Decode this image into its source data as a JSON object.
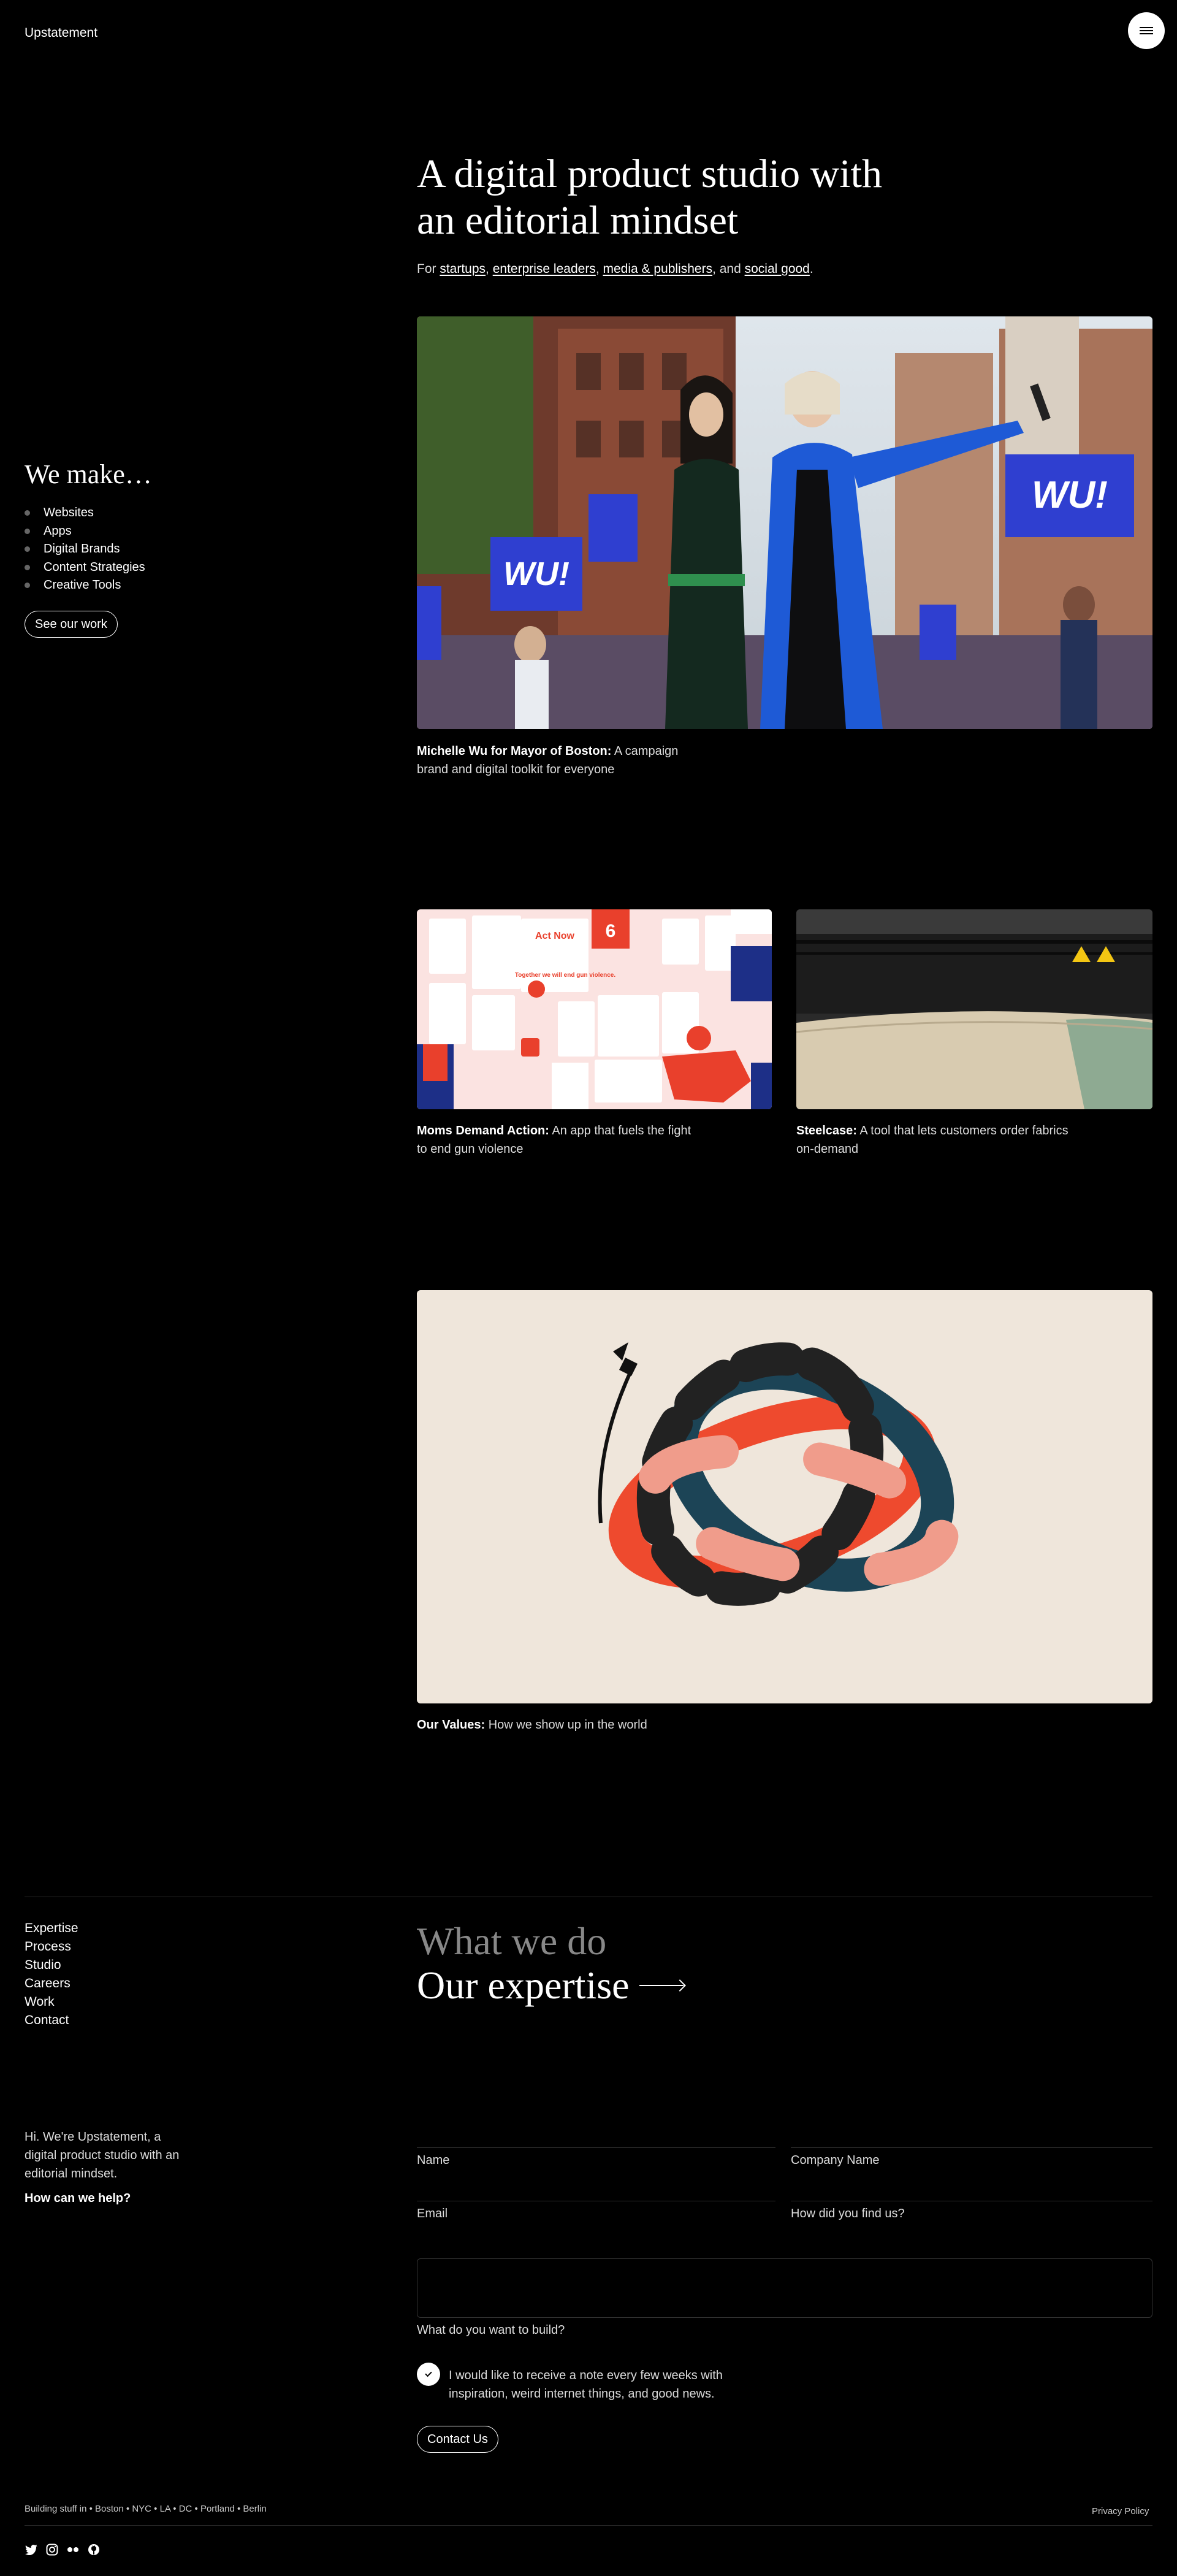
{
  "header": {
    "logo": "Upstatement",
    "menu_icon": "menu-icon"
  },
  "hero": {
    "title_line1": "A digital product studio with",
    "title_line2": "an editorial mindset",
    "sub_for": "For ",
    "sub_links": [
      "startups",
      "enterprise leaders",
      "media & publishers",
      "social good"
    ],
    "sub_sep1": ", ",
    "sub_sep2": ", ",
    "sub_sep3": ", and ",
    "sub_end": "."
  },
  "we_make": {
    "title": "We make…",
    "items": [
      "Websites",
      "Apps",
      "Digital Brands",
      "Content Strategies",
      "Creative Tools"
    ],
    "cta": "See our work"
  },
  "projects": [
    {
      "title": "Michelle Wu for Mayor of Boston:",
      "desc": " A campaign brand and digital toolkit for everyone",
      "sign_text": "WU!"
    },
    {
      "title": "Moms Demand Action:",
      "desc": " An app that fuels the fight to end gun violence",
      "poster_text": "Act Now",
      "poster_sub": "Together we will end gun violence.",
      "badge_num": "6"
    },
    {
      "title": "Steelcase:",
      "desc": " A tool that lets customers order fabrics on-demand"
    },
    {
      "title": "Our Values:",
      "desc": " How we show up in the world"
    }
  ],
  "footer": {
    "nav": [
      "Expertise",
      "Process",
      "Studio",
      "Careers",
      "Work",
      "Contact"
    ],
    "what_we_do": "What we do",
    "our_expertise": "Our expertise",
    "hi_text": "Hi. We're Upstatement, a digital product studio with an editorial mindset.",
    "help": "How can we help?",
    "form": {
      "name": "Name",
      "company": "Company Name",
      "email": "Email",
      "found": "How did you find us?",
      "build": "What do you want to build?",
      "newsletter": "I would like to receive a note every few weeks with inspiration, weird internet things, and good news.",
      "submit": "Contact Us"
    },
    "locations": "Building stuff in • Boston • NYC • LA • DC • Portland • Berlin",
    "privacy": "Privacy Policy",
    "socials": [
      "twitter-icon",
      "instagram-icon",
      "flickr-icon",
      "github-icon"
    ]
  },
  "colors": {
    "background": "#000000",
    "text": "#ffffff",
    "accent_blue": "#2f3fd0",
    "accent_red": "#ee4a2e",
    "cream": "#efe6db"
  }
}
